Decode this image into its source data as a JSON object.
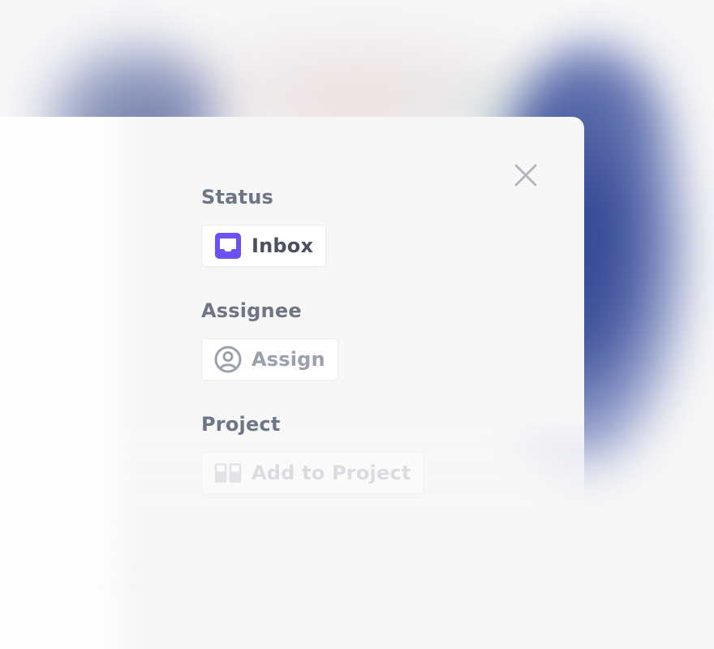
{
  "panel": {
    "status": {
      "label": "Status",
      "value": "Inbox",
      "icon": "inbox-icon",
      "icon_color": "#6e4ff6"
    },
    "assignee": {
      "label": "Assignee",
      "value": "Assign",
      "icon": "user-circle-icon"
    },
    "project": {
      "label": "Project",
      "value": "Add to Project",
      "icon": "project-board-icon"
    },
    "close_icon": "close-icon"
  },
  "colors": {
    "accent": "#6e4ff6",
    "label": "#6e7686",
    "text": "#4a5060",
    "muted": "#9aa1ad"
  }
}
